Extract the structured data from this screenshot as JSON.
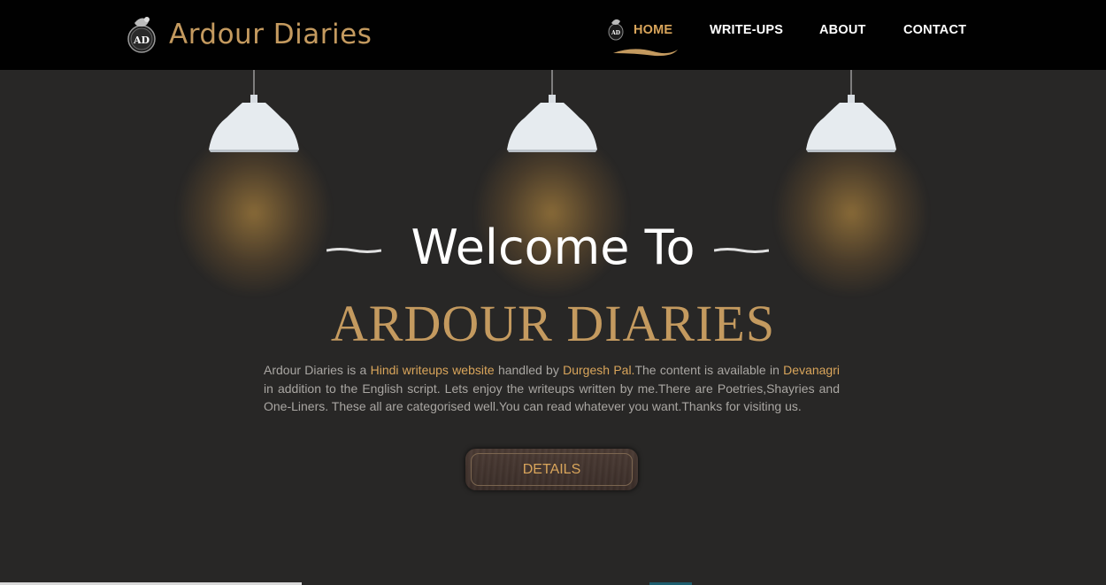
{
  "nav": {
    "brand": "Ardour Diaries",
    "items": [
      {
        "label": "HOME",
        "active": true
      },
      {
        "label": "WRITE-UPS",
        "active": false
      },
      {
        "label": "ABOUT",
        "active": false
      },
      {
        "label": "CONTACT",
        "active": false
      }
    ]
  },
  "hero": {
    "welcome": "Welcome To",
    "title": "ARDOUR DIARIES",
    "description": {
      "t1": "Ardour Diaries is a ",
      "h1": "Hindi writeups website",
      "t2": " handled by ",
      "h2": "Durgesh Pal.",
      "t3": "The content is available in ",
      "h3": "Devanagri",
      "t4": " in addition to the English script. Lets enjoy the writeups written by me.There are Poetries,Shayries and One-Liners. These all are categorised well.You can read whatever you want.Thanks for visiting us."
    },
    "button_label": "DETAILS"
  },
  "colors": {
    "accent": "#d9a55b",
    "brand": "#c49a5f",
    "background": "#282726",
    "navbar": "#010101"
  }
}
